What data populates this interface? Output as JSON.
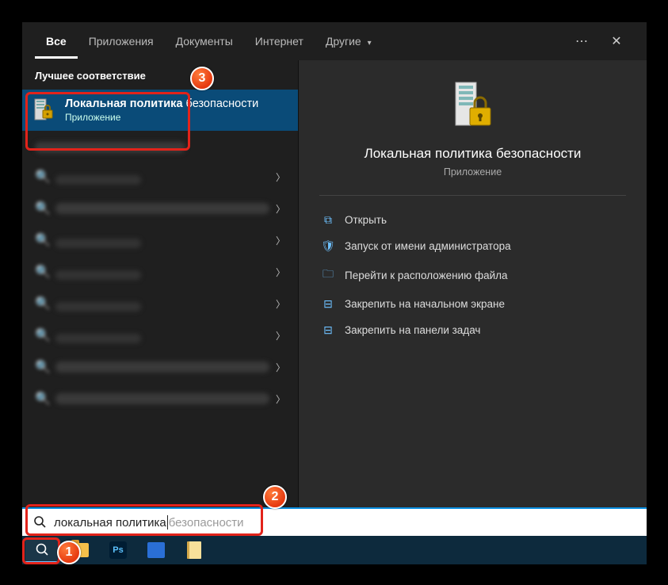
{
  "tabs": {
    "all": "Все",
    "apps": "Приложения",
    "docs": "Документы",
    "internet": "Интернет",
    "other": "Другие"
  },
  "left": {
    "section": "Лучшее соответствие",
    "best": {
      "title_strong": "Локальная политика",
      "title_rest": "безопасности",
      "type": "Приложение"
    }
  },
  "details": {
    "title": "Локальная политика безопасности",
    "type": "Приложение",
    "actions": {
      "open": "Открыть",
      "runas": "Запуск от имени администратора",
      "location": "Перейти к расположению файла",
      "pin_start": "Закрепить на начальном экране",
      "pin_taskbar": "Закрепить на панели задач"
    }
  },
  "search": {
    "typed": "локальная политика",
    "ghost": " безопасности"
  },
  "annotations": {
    "b1": "1",
    "b2": "2",
    "b3": "3"
  }
}
